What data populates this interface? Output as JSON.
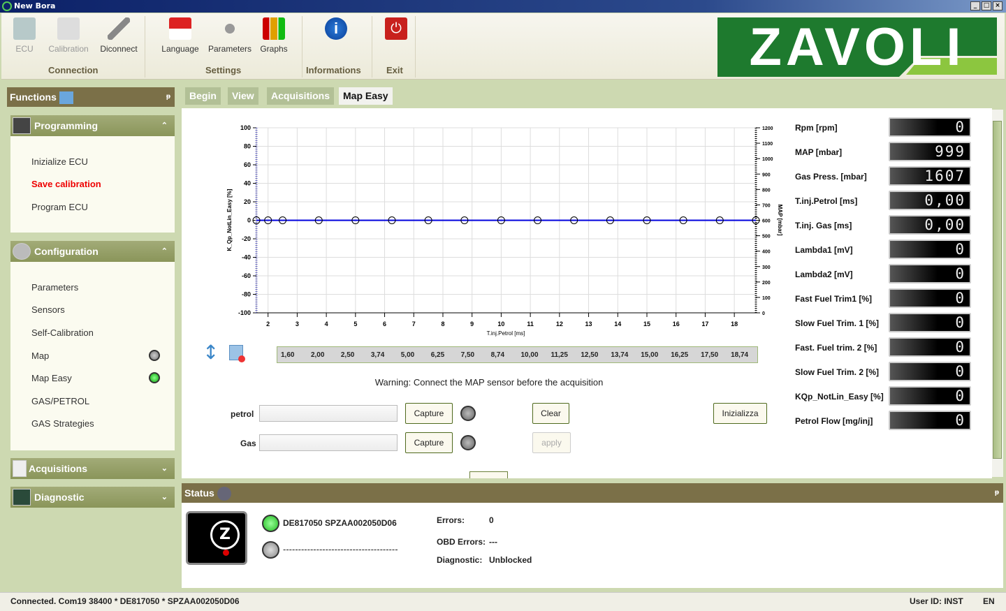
{
  "window": {
    "title": "New Bora"
  },
  "ribbon": {
    "groups": [
      {
        "label": "Connection"
      },
      {
        "label": "Settings"
      },
      {
        "label": "Informations"
      },
      {
        "label": "Exit"
      }
    ],
    "buttons": [
      {
        "label": "ECU",
        "icon": "ecu-board-icon",
        "enabled": false
      },
      {
        "label": "Calibration",
        "icon": "calibration-icon",
        "enabled": false
      },
      {
        "label": "Diconnect",
        "icon": "disconnect-cable-icon",
        "enabled": true
      },
      {
        "label": "Language",
        "icon": "flags-icon",
        "enabled": true
      },
      {
        "label": "Parameters",
        "icon": "wrench-gear-icon",
        "enabled": true
      },
      {
        "label": "Graphs",
        "icon": "bar-graph-icon",
        "enabled": true
      }
    ],
    "logo": "ZAVOLI"
  },
  "functions": {
    "title": "Functions",
    "sections": [
      {
        "title": "Programming",
        "items": [
          {
            "label": "Inizialize ECU"
          },
          {
            "label": "Save calibration"
          },
          {
            "label": "Program ECU"
          }
        ]
      },
      {
        "title": "Configuration",
        "items": [
          {
            "label": "Parameters"
          },
          {
            "label": "Sensors"
          },
          {
            "label": "Self-Calibration"
          },
          {
            "label": "Map",
            "led": "gray"
          },
          {
            "label": "Map Easy",
            "led": "green"
          },
          {
            "label": "GAS/PETROL"
          },
          {
            "label": "GAS Strategies"
          }
        ]
      },
      {
        "title": "Acquisitions"
      },
      {
        "title": "Diagnostic"
      }
    ]
  },
  "tabs": [
    {
      "label": "Begin"
    },
    {
      "label": "View"
    },
    {
      "label": "Acquisitions"
    },
    {
      "label": "Map Easy",
      "active": true
    }
  ],
  "chart_data": {
    "type": "line",
    "xlabel": "T.inj.Petrol [ms]",
    "ylabel": "K_Qp_NotLin_Easy [%]",
    "y2label": "MAP [mbar]",
    "xlim": [
      1.6,
      18.74
    ],
    "ylim": [
      -100,
      100
    ],
    "y2lim": [
      0,
      1200
    ],
    "xticks": [
      2,
      3,
      4,
      5,
      6,
      7,
      8,
      9,
      10,
      11,
      12,
      13,
      14,
      15,
      16,
      17,
      18
    ],
    "yticks": [
      -100,
      -80,
      -60,
      -40,
      -20,
      0,
      20,
      40,
      60,
      80,
      100
    ],
    "y2ticks": [
      0,
      100,
      200,
      300,
      400,
      500,
      600,
      700,
      800,
      900,
      1000,
      1100,
      1200
    ],
    "grid": true,
    "line_color": "#0000dd",
    "x": [
      1.6,
      2.0,
      2.5,
      3.74,
      5.0,
      6.25,
      7.5,
      8.74,
      10.0,
      11.25,
      12.5,
      13.74,
      15.0,
      16.25,
      17.5,
      18.74
    ],
    "y": [
      0,
      0,
      0,
      0,
      0,
      0,
      0,
      0,
      0,
      0,
      0,
      0,
      0,
      0,
      0,
      0
    ]
  },
  "points_table": [
    "1,60",
    "2,00",
    "2,50",
    "3,74",
    "5,00",
    "6,25",
    "7,50",
    "8,74",
    "10,00",
    "11,25",
    "12,50",
    "13,74",
    "15,00",
    "16,25",
    "17,50",
    "18,74"
  ],
  "warning": "Warning: Connect the MAP sensor before the acquisition",
  "form": {
    "petrol_label": "petrol",
    "gas_label": "Gas",
    "petrol_value": "",
    "gas_value": "",
    "capture": "Capture",
    "clear": "Clear",
    "apply": "apply",
    "init": "Inizializza"
  },
  "readouts": [
    {
      "label": "Rpm [rpm]",
      "value": "0"
    },
    {
      "label": "MAP [mbar]",
      "value": "999"
    },
    {
      "label": "Gas Press. [mbar]",
      "value": "1607"
    },
    {
      "label": "T.inj.Petrol [ms]",
      "value": "0,00"
    },
    {
      "label": "T.inj. Gas [ms]",
      "value": "0,00"
    },
    {
      "label": "Lambda1 [mV]",
      "value": "0"
    },
    {
      "label": "Lambda2 [mV]",
      "value": "0"
    },
    {
      "label": "Fast Fuel Trim1 [%]",
      "value": "0"
    },
    {
      "label": "Slow Fuel Trim. 1 [%]",
      "value": "0"
    },
    {
      "label": "Fast. Fuel trim. 2 [%]",
      "value": "0"
    },
    {
      "label": "Slow Fuel Trim. 2 [%]",
      "value": "0"
    },
    {
      "label": "KQp_NotLin_Easy [%]",
      "value": "0"
    },
    {
      "label": "Petrol Flow [mg/inj]",
      "value": "0"
    }
  ],
  "status": {
    "title": "Status",
    "device": "DE817050 SPZAA002050D06",
    "device2": "--------------------------------------",
    "errors_label": "Errors:",
    "errors": "0",
    "obd_label": "OBD Errors:",
    "obd": "---",
    "diag_label": "Diagnostic:",
    "diag": "Unblocked"
  },
  "statusbar": {
    "connection": "Connected. Com19 38400 * DE817050 * SPZAA002050D06",
    "user": "User ID: INST",
    "lang": "EN"
  },
  "colors": {
    "header": "#7b7048",
    "background": "#cdd9b1",
    "accent_green": "#1e7a2e"
  }
}
